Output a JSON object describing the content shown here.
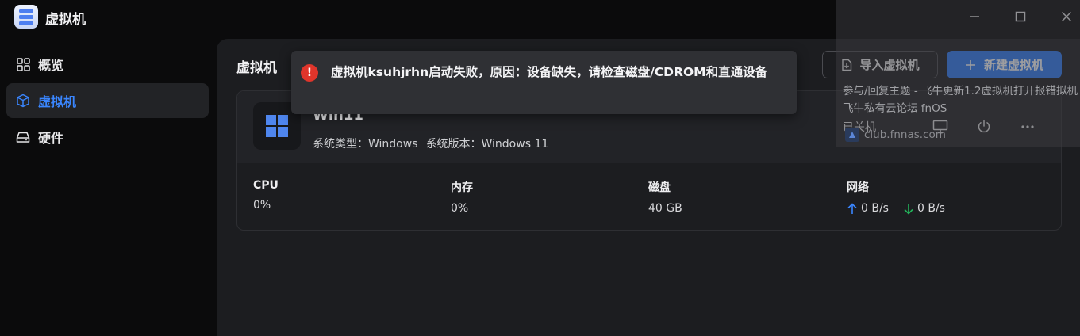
{
  "app": {
    "title": "虚拟机"
  },
  "window_controls": {
    "minimize": "minimize-icon",
    "maximize": "maximize-icon",
    "close": "close-icon"
  },
  "sidebar": {
    "items": [
      {
        "label": "概览",
        "icon": "grid-icon",
        "active": false
      },
      {
        "label": "虚拟机",
        "icon": "cube-icon",
        "active": true
      },
      {
        "label": "硬件",
        "icon": "drive-icon",
        "active": false
      }
    ]
  },
  "main": {
    "title": "虚拟机",
    "import_label": "导入虚拟机",
    "new_label": "新建虚拟机"
  },
  "vm": {
    "name": "Win11",
    "type_label": "系统类型：Windows",
    "version_label": "系统版本：Windows 11",
    "status": "已关机",
    "stats": {
      "cpu_label": "CPU",
      "cpu_value": "0%",
      "mem_label": "内存",
      "mem_value": "0%",
      "disk_label": "磁盘",
      "disk_value": "40 GB",
      "net_label": "网络",
      "net_up": "0 B/s",
      "net_down": "0 B/s"
    }
  },
  "toast": {
    "icon": "error-icon",
    "message": "虚拟机ksuhjrhn启动失败，原因：设备缺失，请检查磁盘/CDROM和直通设备"
  },
  "overlay": {
    "text": "参与/回复主题 - 飞牛更新1.2虚拟机打开报错拟机 飞牛私有云论坛 fnOS",
    "link": "club.fnnas.com"
  },
  "colors": {
    "accent": "#2f7af5",
    "error": "#e0352b",
    "net_up": "#3a86ff",
    "net_down": "#22b35a"
  }
}
